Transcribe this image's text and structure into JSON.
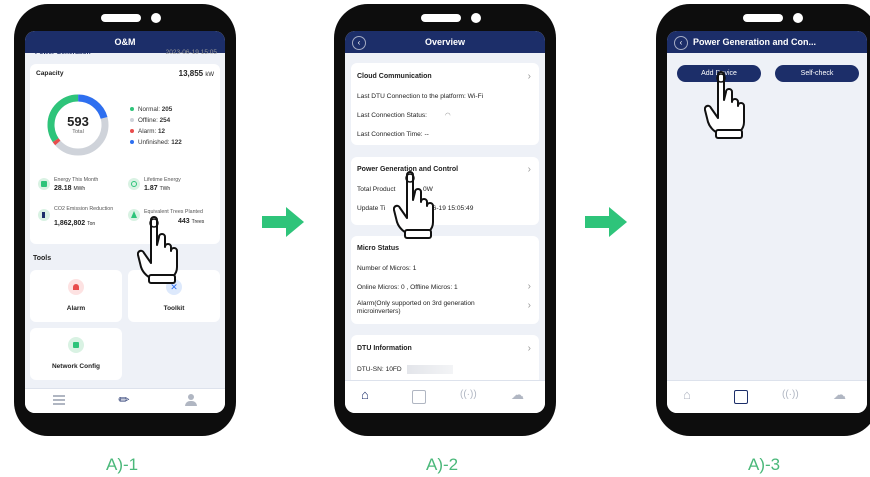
{
  "captions": [
    "A)-1",
    "A)-2",
    "A)-3"
  ],
  "screen1": {
    "title": "O&M",
    "section_cut": "Power Generation",
    "date_cut": "2023-06-19 15:05",
    "capacity_label": "Capacity",
    "capacity_value": "13,855",
    "capacity_unit": "kW",
    "total_value": "593",
    "total_label": "Total",
    "legend": [
      {
        "label": "Normal:",
        "value": "205",
        "color": "#2ec47a"
      },
      {
        "label": "Offline:",
        "value": "254",
        "color": "#cfd3da"
      },
      {
        "label": "Alarm:",
        "value": "12",
        "color": "#e84c4c"
      },
      {
        "label": "Unfinished:",
        "value": "122",
        "color": "#2e6ff0"
      }
    ],
    "stats": [
      {
        "label": "Energy This Month",
        "value": "28.18",
        "unit": "MWh"
      },
      {
        "label": "Lifetime Energy",
        "value": "1.87",
        "unit": "TWh"
      },
      {
        "label": "CO2 Emission Reduction",
        "value": "1,862,802",
        "unit": "Ton"
      },
      {
        "label": "Equivalent Trees Planted",
        "value": "443",
        "unit": "Trees"
      }
    ],
    "tools_label": "Tools",
    "tools": [
      "Alarm",
      "Toolkit",
      "Network Config"
    ]
  },
  "screen2": {
    "title": "Overview",
    "cloud_title": "Cloud Communication",
    "cloud_lines": [
      "Last DTU Connection to the platform:  Wi-Fi",
      "Last Connection Status:",
      "Last Connection Time:  --"
    ],
    "power_title": "Power Generation and Control",
    "power_line1": "Total Product",
    "power_line1b": "0W",
    "power_line2": "Update Ti",
    "power_line2b": "06-19 15:05:49",
    "micro_title": "Micro Status",
    "micro_lines": [
      "Number of Micros:  1",
      "Online Micros:  0 , Offline Micros:  1",
      "Alarm(Only supported on 3rd generation",
      "microinverters)"
    ],
    "dtu_title": "DTU Information",
    "dtu_sn": "DTU-SN:  10FD"
  },
  "screen3": {
    "title": "Power Generation and Con...",
    "add_device": "Add Device",
    "self_check": "Self-check"
  },
  "colors": {
    "header": "#1c2e69",
    "accent": "#1c2e69",
    "caption": "#4ab87a",
    "arrow": "#2ec47a"
  }
}
